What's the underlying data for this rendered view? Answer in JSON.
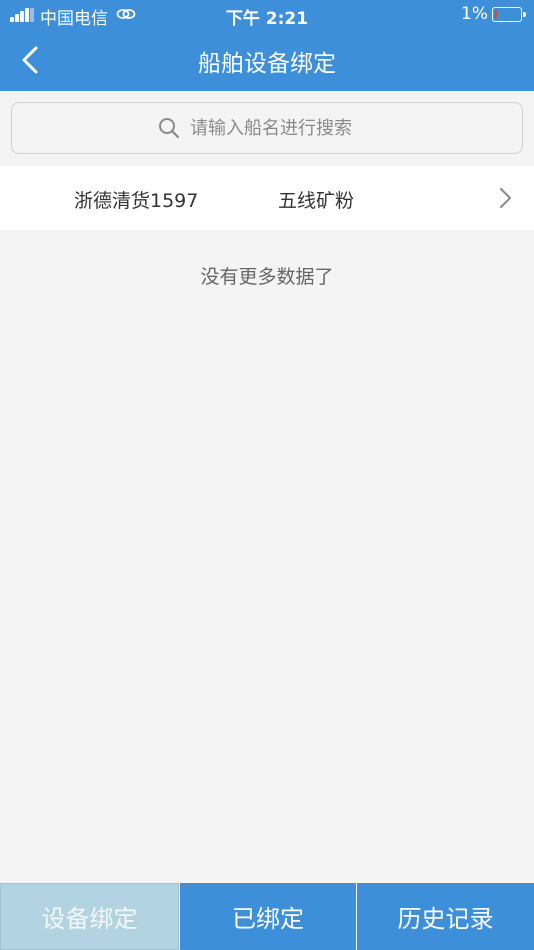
{
  "status_bar": {
    "carrier": "中国电信",
    "time": "下午 2:21",
    "battery_percent": "1%"
  },
  "nav": {
    "title": "船舶设备绑定",
    "back_icon": "chevron-left-icon"
  },
  "search": {
    "placeholder": "请输入船名进行搜索",
    "value": "",
    "icon": "search-icon"
  },
  "ship_list": [
    {
      "name": "浙德清货1597",
      "cargo": "五线矿粉"
    }
  ],
  "list_footer": "没有更多数据了",
  "tabs": [
    {
      "label": "设备绑定",
      "selected": true
    },
    {
      "label": "已绑定",
      "selected": false
    },
    {
      "label": "历史记录",
      "selected": false
    }
  ],
  "colors": {
    "primary": "#3e8fd9",
    "selected_tab": "#b1d3e2",
    "background": "#f4f4f4"
  }
}
